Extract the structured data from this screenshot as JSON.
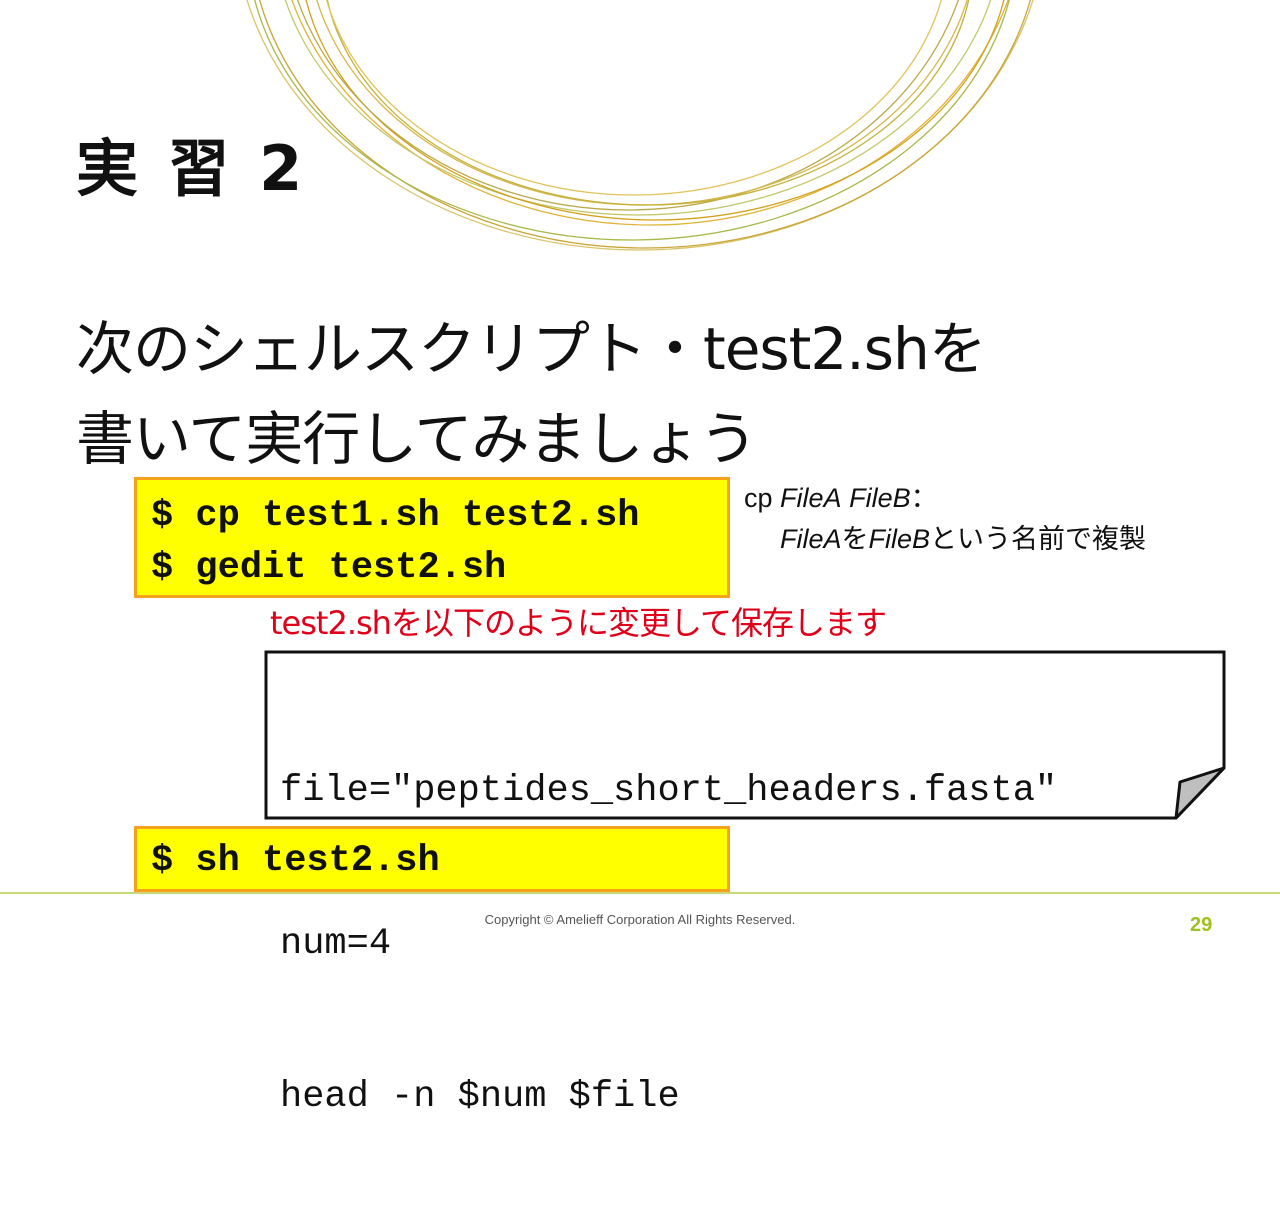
{
  "slide": {
    "title": "実 習 2",
    "instruction_line1": "次のシェルスクリプト・test2.shを",
    "instruction_line2": "書いて実行してみましょう"
  },
  "commands_top": [
    "$ cp test1.sh test2.sh",
    "$ gedit test2.sh"
  ],
  "note": {
    "cmd": "cp",
    "arg_a": "FileA",
    "arg_b": "FileB",
    "colon": "：",
    "desc_a": "FileA",
    "desc_mid": "を",
    "desc_b": "FileB",
    "desc_rest": "という名前で複製"
  },
  "edit_instruction": "test2.shを以下のように変更して保存します",
  "script_lines": [
    "file=\"peptides_short_headers.fasta\"",
    "num=4",
    "head -n $num $file"
  ],
  "command_bottom": "$ sh test2.sh",
  "footer": {
    "copyright": "Copyright © Amelieff Corporation All Rights Reserved.",
    "page_number": "29"
  },
  "colors": {
    "command_bg": "#ffff00",
    "command_border": "#f4a21b",
    "accent_red": "#e0001a",
    "footer_rule": "#c8d97a",
    "page_number": "#9ec21f",
    "decor_gold": "#d4a017"
  }
}
